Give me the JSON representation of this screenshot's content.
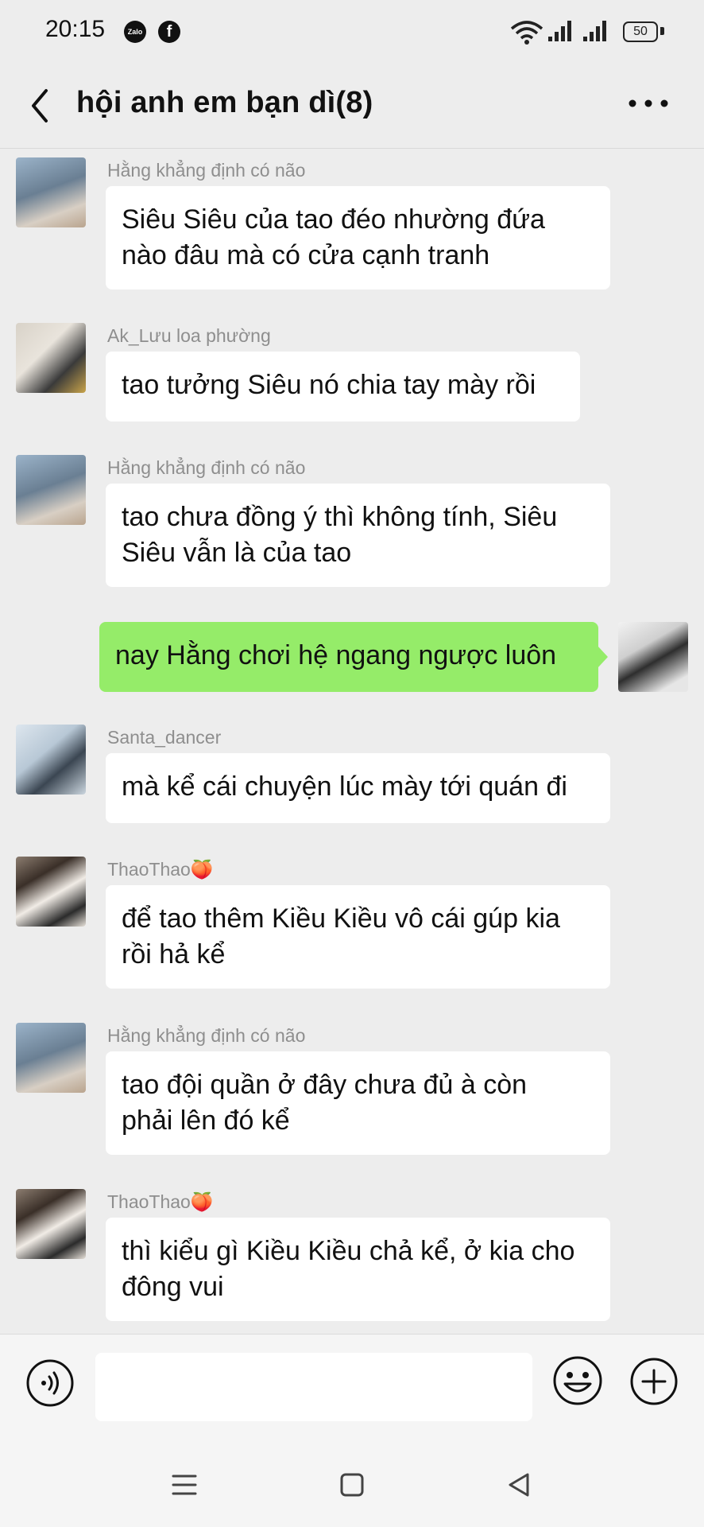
{
  "status_bar": {
    "time": "20:15",
    "apps": [
      "zalo-icon",
      "facebook-icon"
    ],
    "zalo_text": "Zalo",
    "icons": [
      "wifi-icon",
      "signal-icon",
      "signal-icon"
    ],
    "battery": "50"
  },
  "header": {
    "title": "hội anh em bạn dì(8)",
    "back_icon": "chevron-left-icon",
    "menu_icon": "more-dots-icon"
  },
  "messages": [
    {
      "sender": "Hằng khẳng định có não",
      "text": [
        "Siêu Siêu của tao đéo nhường đứa",
        "nào đâu mà có cửa cạnh tranh"
      ],
      "avatar": "avatar-hang"
    },
    {
      "sender": "Ak_Lưu loa phường",
      "text": [
        "tao tưởng Siêu nó chia tay mày rồi"
      ],
      "avatar": "avatar-ak-luu"
    },
    {
      "sender": "Hằng khẳng định có não",
      "text": [
        "tao chưa đồng ý thì không tính, Siêu",
        "Siêu vẫn là của tao"
      ],
      "avatar": "avatar-hang"
    },
    {
      "sender": "",
      "text": [
        "nay Hằng chơi hệ ngang ngược luôn"
      ],
      "avatar": "avatar-me",
      "mine": true
    },
    {
      "sender": "Santa_dancer",
      "text": [
        "mà kể cái chuyện lúc mày tới quán đi"
      ],
      "avatar": "avatar-santa"
    },
    {
      "sender": "ThaoThao🍑",
      "text": [
        "để tao thêm Kiều Kiều vô cái gúp kia",
        "rồi hả kể"
      ],
      "avatar": "avatar-thaothao"
    },
    {
      "sender": "Hằng khẳng định có não",
      "text": [
        "tao đội quần ở đây chưa đủ à còn",
        "phải lên đó kể"
      ],
      "avatar": "avatar-hang"
    },
    {
      "sender": "ThaoThao🍑",
      "text": [
        "thì kiểu gì Kiều Kiều chả kể, ở kia cho",
        "đông vui"
      ],
      "avatar": "avatar-thaothao"
    }
  ],
  "input_bar": {
    "value": "",
    "icons": [
      "voice-icon",
      "emoji-icon",
      "plus-icon"
    ]
  },
  "nav_bar": {
    "icons": [
      "menu-icon",
      "home-icon",
      "back-icon"
    ]
  },
  "colors": {
    "background": "#ededed",
    "bubble_other": "#ffffff",
    "bubble_me": "#95ec69",
    "sender": "#8e8e8e"
  }
}
